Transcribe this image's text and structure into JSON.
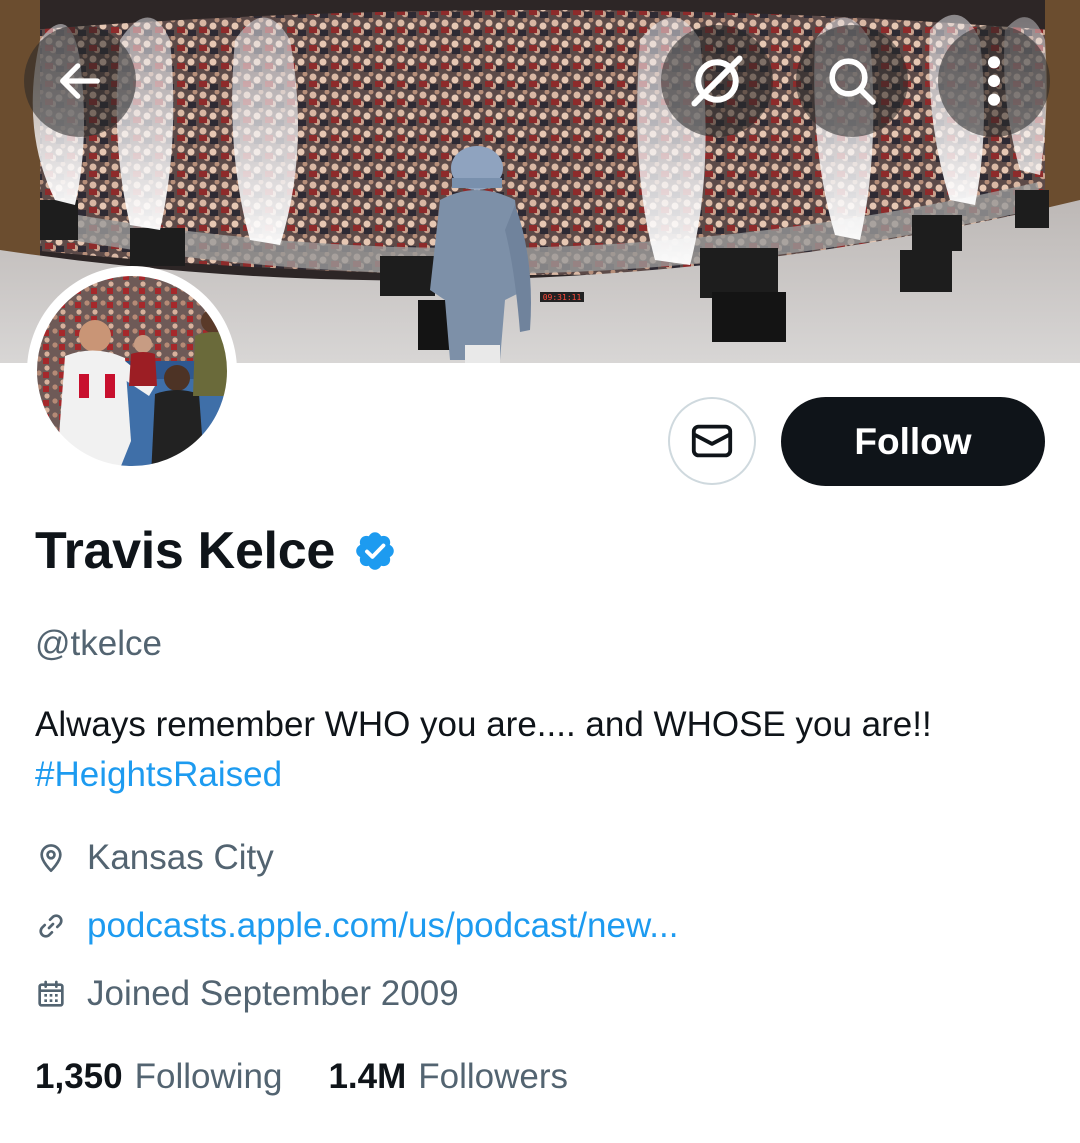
{
  "profile": {
    "display_name": "Travis Kelce",
    "handle": "@tkelce",
    "verified": true,
    "bio_text": "Always remember WHO you are.... and WHOSE you are!!",
    "bio_hashtag": "#HeightsRaised",
    "location": "Kansas City",
    "website": "podcasts.apple.com/us/podcast/new...",
    "joined": "Joined September 2009"
  },
  "stats": {
    "following_count": "1,350",
    "following_label": "Following",
    "followers_count": "1.4M",
    "followers_label": "Followers"
  },
  "actions": {
    "follow_label": "Follow"
  },
  "banner": {
    "stage_display_text": "09:31:11"
  },
  "icons": {
    "back": "arrow-left-icon",
    "grok": "grok-icon",
    "search": "search-icon",
    "more": "more-vertical-icon",
    "message": "envelope-icon",
    "verified": "verified-badge-icon",
    "location": "location-pin-icon",
    "link": "link-icon",
    "calendar": "calendar-icon"
  },
  "colors": {
    "accent": "#1d9bf0",
    "text_primary": "#0f1419",
    "text_secondary": "#536471",
    "follow_button_bg": "#0f1419"
  }
}
